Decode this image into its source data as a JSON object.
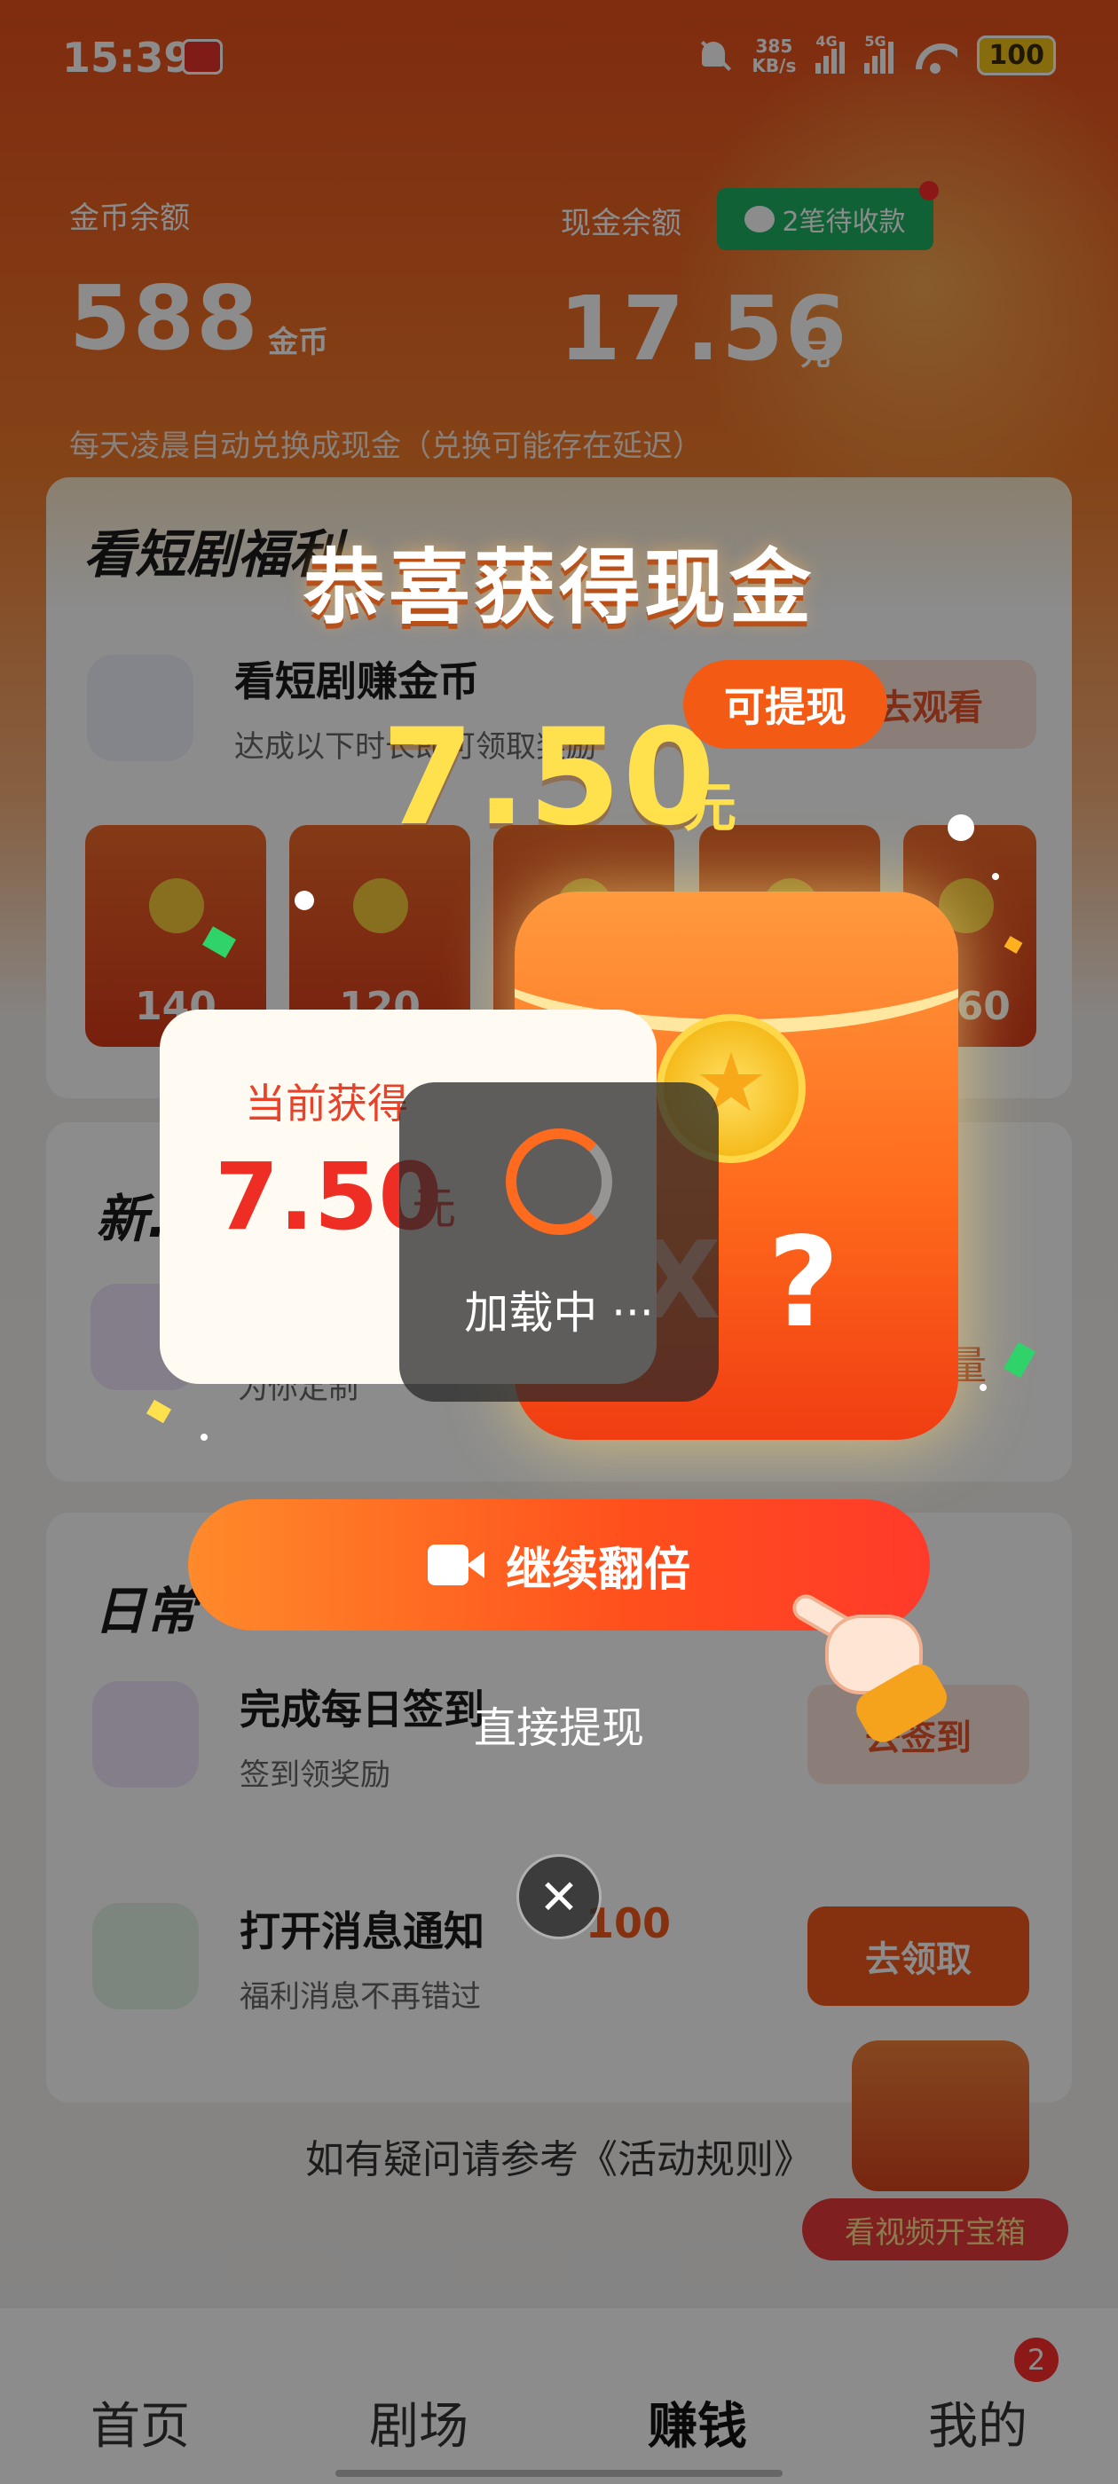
{
  "status_bar": {
    "time": "15:39",
    "net_speed_value": "385",
    "net_speed_unit": "KB/s",
    "signal_1": "4G",
    "signal_2": "5G",
    "battery": "100"
  },
  "balances": {
    "coin_label": "金币余额",
    "coin_value": "588",
    "coin_unit": "金币",
    "cash_label": "现金余额",
    "cash_value": "17.56",
    "cash_unit": "元",
    "pending_label": "2笔待收款",
    "exchange_note": "每天凌晨自动兑换成现金（兑换可能存在延迟）"
  },
  "drama_card": {
    "title": "看短剧福利",
    "task_title": "看短剧赚金币",
    "task_sub": "达成以下时长即可领取奖励",
    "button": "去观看",
    "packets": [
      "140",
      "120",
      "",
      "",
      "360"
    ]
  },
  "new_card": {
    "title": "新...",
    "task_sub": "为你定制",
    "button_hint": "量"
  },
  "daily_card": {
    "title": "日常",
    "sign_title": "完成每日签到",
    "sign_sub": "签到领奖励",
    "sign_button": "去签到",
    "notify_title": "打开消息通知",
    "notify_reward": "100",
    "notify_sub": "福利消息不再错过",
    "notify_button": "去领取"
  },
  "rules_link": "如有疑问请参考《活动规则》",
  "treasure_button": "看视频开宝箱",
  "bottom_nav": {
    "items": [
      "首页",
      "剧场",
      "赚钱",
      "我的"
    ],
    "active": "赚钱",
    "badge": "2"
  },
  "modal": {
    "title": "恭喜获得现金",
    "amount": "7.50",
    "amount_unit": "元",
    "withdraw_tag": "可提现",
    "current_label": "当前获得",
    "current_amount": "7.50",
    "current_unit": "元",
    "packet_x": "X",
    "packet_q": "?",
    "loading_text": "加载中 ···",
    "double_button": "继续翻倍",
    "direct_withdraw": "直接提现",
    "close": "✕"
  },
  "colors": {
    "accent_orange": "#f25a1e",
    "gold": "#ffe14d",
    "red": "#ee2e24",
    "wechat_green": "#1eb161"
  }
}
